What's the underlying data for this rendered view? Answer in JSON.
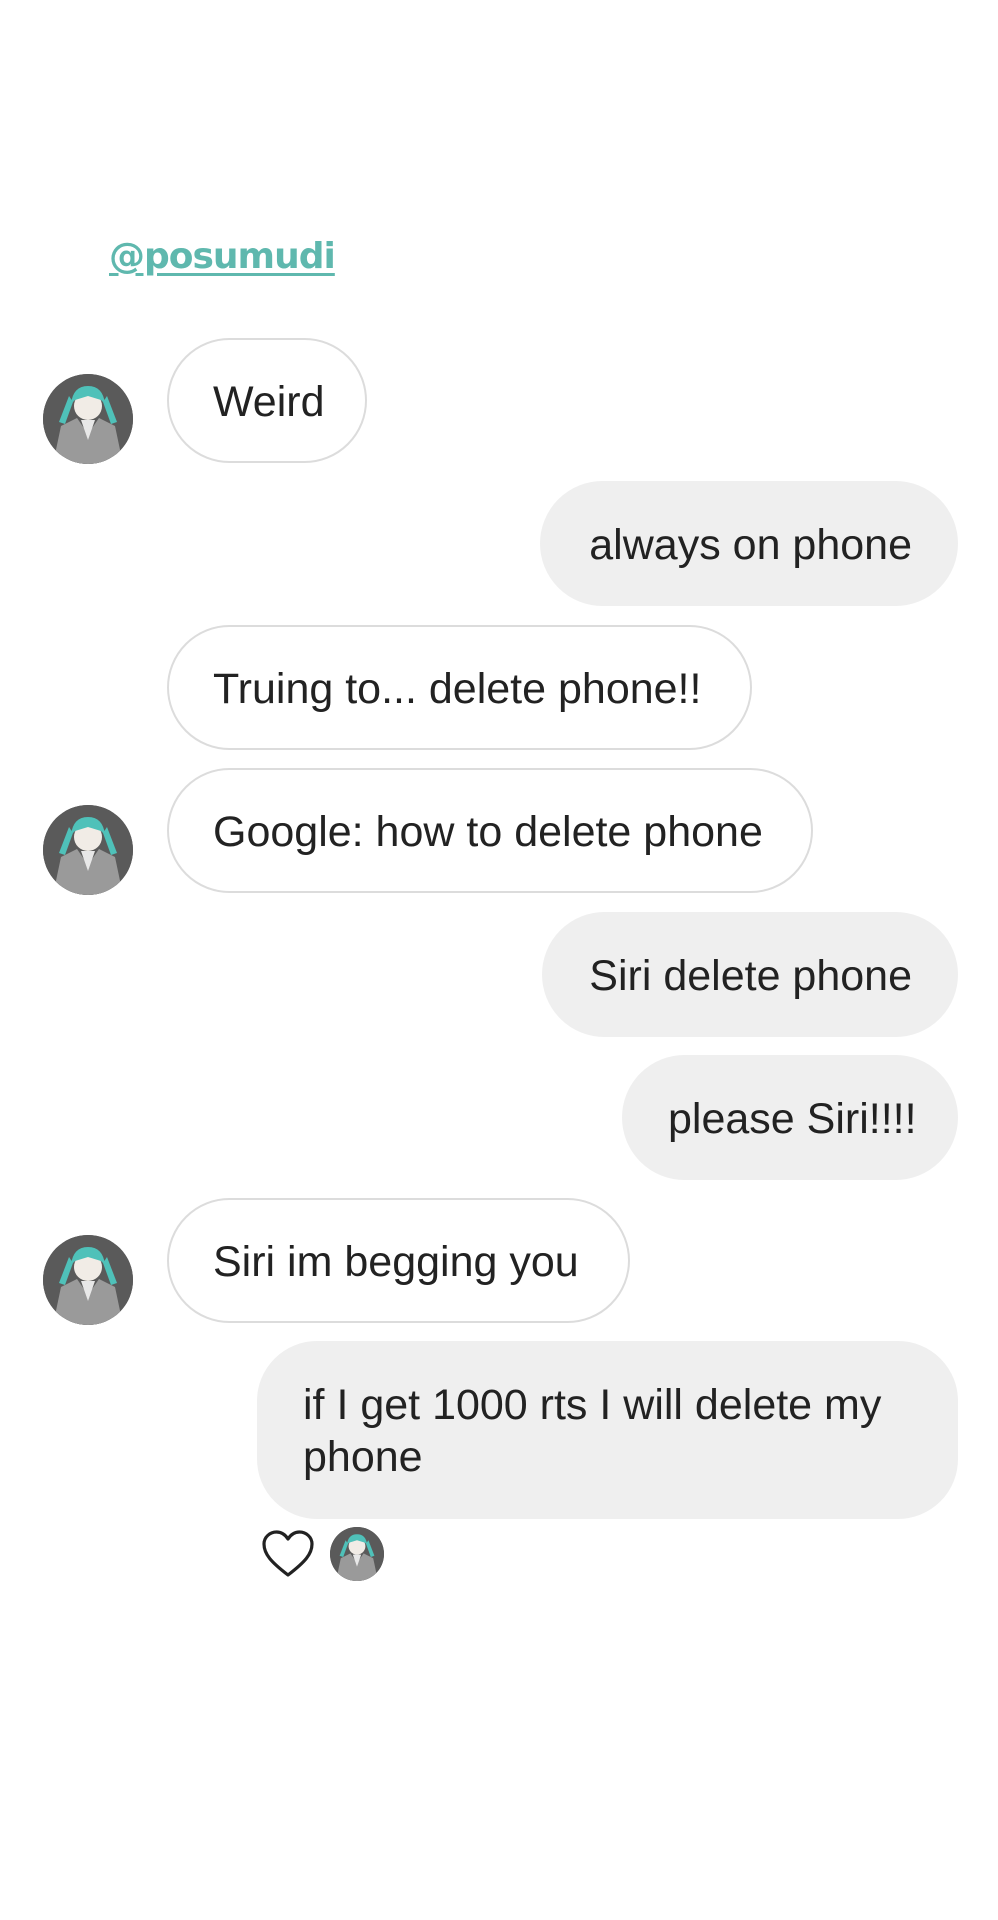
{
  "header": {
    "handle": "@posumudi"
  },
  "messages": [
    {
      "side": "in",
      "text": "Weird"
    },
    {
      "side": "out",
      "text": "always on phone"
    },
    {
      "side": "in",
      "text": "Truing to... delete phone!!"
    },
    {
      "side": "in",
      "text": "Google: how to delete phone"
    },
    {
      "side": "out",
      "text": "Siri delete phone"
    },
    {
      "side": "out",
      "text": "please Siri!!!!"
    },
    {
      "side": "in",
      "text": "Siri im begging you"
    },
    {
      "side": "out",
      "text": "if I get 1000 rts I will delete my phone"
    }
  ],
  "reactions": {
    "icon": "heart-icon",
    "reactor": "avatar"
  },
  "colors": {
    "handle": "#5fb8ae",
    "incoming_bubble": "#ffffff",
    "incoming_border": "#dcdcdc",
    "outgoing_bubble": "#efefef",
    "text": "#222222",
    "avatar_hair": "#4fc1b9"
  }
}
